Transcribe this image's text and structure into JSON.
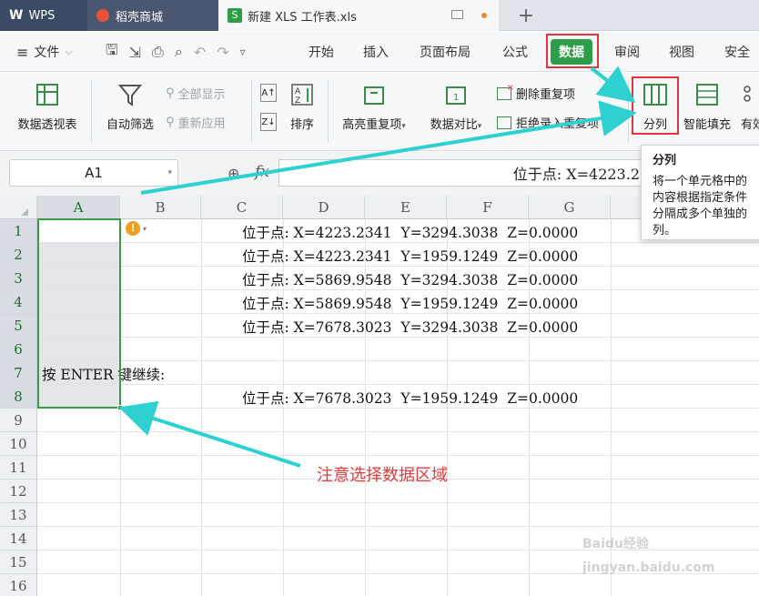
{
  "tabs": {
    "wps": "WPS",
    "daoke": "稻壳商城",
    "file": "新建 XLS 工作表.xls"
  },
  "menu": {
    "file": "文件",
    "items": [
      "开始",
      "插入",
      "页面布局",
      "公式",
      "数据",
      "审阅",
      "视图",
      "安全"
    ],
    "active": "数据"
  },
  "ribbon": {
    "pivot": "数据透视表",
    "autofilter": "自动筛选",
    "show_all": "全部显示",
    "reapply": "重新应用",
    "sort": "排序",
    "highlight_dup": "高亮重复项",
    "compare": "数据对比",
    "remove_dup": "删除重复项",
    "reject_dup": "拒绝录入重复项",
    "split_col": "分列",
    "smart_fill": "智能填充",
    "more": "有效"
  },
  "tooltip": {
    "title": "分列",
    "body": "将一个单元格中的内容根据指定条件分隔成多个单独的列。"
  },
  "formula": {
    "name_box": "A1",
    "content": "位于点: X=4223.2"
  },
  "grid": {
    "columns": [
      "A",
      "B",
      "C",
      "D",
      "E",
      "F",
      "G"
    ],
    "rows": [
      "1",
      "2",
      "3",
      "4",
      "5",
      "6",
      "7",
      "8",
      "9",
      "10",
      "11",
      "12",
      "13",
      "14",
      "15",
      "16"
    ],
    "cells": [
      {
        "row": 1,
        "text": "位于点: X=4223.2341  Y=3294.3038  Z=0.0000"
      },
      {
        "row": 2,
        "text": "位于点: X=4223.2341  Y=1959.1249  Z=0.0000"
      },
      {
        "row": 3,
        "text": "位于点: X=5869.9548  Y=3294.3038  Z=0.0000"
      },
      {
        "row": 4,
        "text": "位于点: X=5869.9548  Y=1959.1249  Z=0.0000"
      },
      {
        "row": 5,
        "text": "位于点: X=7678.3023  Y=3294.3038  Z=0.0000"
      },
      {
        "row": 7,
        "text": "按 ENTER 键继续:"
      },
      {
        "row": 8,
        "text": "位于点: X=7678.3023  Y=1959.1249  Z=0.0000"
      }
    ]
  },
  "annotation": "注意选择数据区域",
  "watermark": "Baidu经验 jingyan.baidu.com",
  "colors": {
    "accent_green": "#2e9d47",
    "highlight_red": "#e2353c",
    "arrow_cyan": "#2fd0d0",
    "annotation_red": "#e23a3a"
  }
}
